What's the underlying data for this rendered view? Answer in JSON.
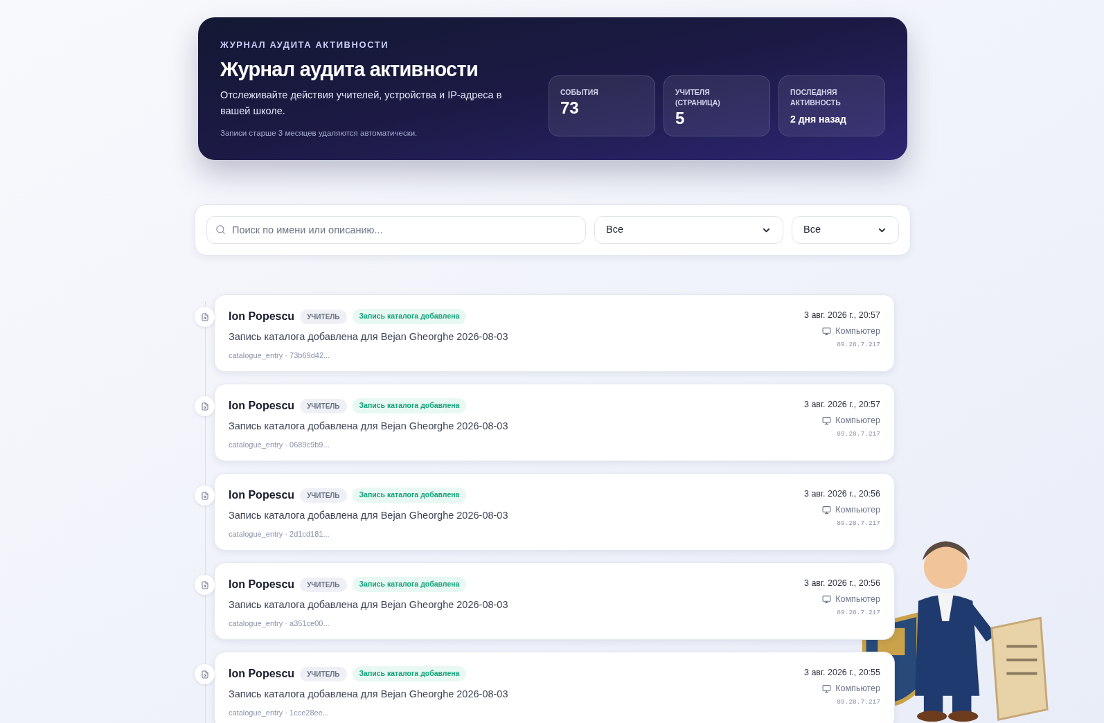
{
  "header": {
    "eyebrow": "ЖУРНАЛ АУДИТА АКТИВНОСТИ",
    "title": "Журнал аудита активности",
    "description": "Отслеживайте действия учителей, устройства и IP-адреса в вашей школе.",
    "note": "Записи старше 3 месяцев удаляются автоматически.",
    "stats": [
      {
        "label": "СОБЫТИЯ",
        "value": "73",
        "kind": "big"
      },
      {
        "label": "УЧИТЕЛЯ (СТРАНИЦА)",
        "value": "5",
        "kind": "big"
      },
      {
        "label": "ПОСЛЕДНЯЯ АКТИВНОСТЬ",
        "value": "2 дня назад",
        "kind": "small"
      }
    ]
  },
  "filters": {
    "search": {
      "placeholder": "Поиск по имени или описанию..."
    },
    "selects": [
      "Все",
      "Все"
    ]
  },
  "events": [
    {
      "user": "Ion Popescu",
      "role": "УЧИТЕЛЬ",
      "action": "Запись каталога добавлена",
      "description": "Запись каталога добавлена для Bejan Gheorghe 2026-08-03",
      "meta": "catalogue_entry · 73b69d42...",
      "time": "3 авг. 2026 г., 20:57",
      "device": "Компьютер",
      "ip": "89.28.7.217"
    },
    {
      "user": "Ion Popescu",
      "role": "УЧИТЕЛЬ",
      "action": "Запись каталога добавлена",
      "description": "Запись каталога добавлена для Bejan Gheorghe 2026-08-03",
      "meta": "catalogue_entry · 0689c9b9...",
      "time": "3 авг. 2026 г., 20:57",
      "device": "Компьютер",
      "ip": "89.28.7.217"
    },
    {
      "user": "Ion Popescu",
      "role": "УЧИТЕЛЬ",
      "action": "Запись каталога добавлена",
      "description": "Запись каталога добавлена для Bejan Gheorghe 2026-08-03",
      "meta": "catalogue_entry · 2d1cd181...",
      "time": "3 авг. 2026 г., 20:56",
      "device": "Компьютер",
      "ip": "89.28.7.217"
    },
    {
      "user": "Ion Popescu",
      "role": "УЧИТЕЛЬ",
      "action": "Запись каталога добавлена",
      "description": "Запись каталога добавлена для Bejan Gheorghe 2026-08-03",
      "meta": "catalogue_entry · a351ce00...",
      "time": "3 авг. 2026 г., 20:56",
      "device": "Компьютер",
      "ip": "89.28.7.217"
    },
    {
      "user": "Ion Popescu",
      "role": "УЧИТЕЛЬ",
      "action": "Запись каталога добавлена",
      "description": "Запись каталога добавлена для Bejan Gheorghe 2026-08-03",
      "meta": "catalogue_entry · 1cce28ee...",
      "time": "3 авг. 2026 г., 20:55",
      "device": "Компьютер",
      "ip": "89.28.7.217"
    }
  ]
}
